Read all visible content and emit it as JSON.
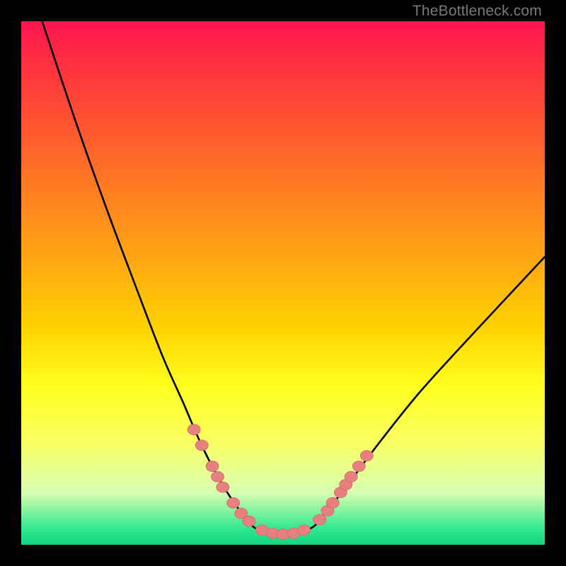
{
  "watermark": "TheBottleneck.com",
  "chart_data": {
    "type": "line",
    "title": "",
    "xlabel": "",
    "ylabel": "",
    "xlim": [
      0,
      100
    ],
    "ylim": [
      0,
      100
    ],
    "series": [
      {
        "name": "bottleneck-curve",
        "x": [
          4,
          10,
          16,
          22,
          27,
          31,
          34,
          37,
          40,
          43,
          45,
          49,
          55,
          58,
          62,
          68,
          76,
          86,
          100
        ],
        "y": [
          100,
          82,
          65,
          49,
          36,
          27,
          20,
          14,
          9,
          5,
          3,
          2,
          3,
          6,
          11,
          19,
          29,
          40,
          55
        ]
      }
    ],
    "markers": {
      "name": "beads",
      "points": [
        {
          "x": 33,
          "y": 22
        },
        {
          "x": 34.5,
          "y": 19
        },
        {
          "x": 36.5,
          "y": 15
        },
        {
          "x": 37.5,
          "y": 13
        },
        {
          "x": 38.5,
          "y": 11
        },
        {
          "x": 40.5,
          "y": 8
        },
        {
          "x": 42,
          "y": 6
        },
        {
          "x": 43.5,
          "y": 4.5
        },
        {
          "x": 46,
          "y": 2.8
        },
        {
          "x": 48,
          "y": 2.2
        },
        {
          "x": 50,
          "y": 2
        },
        {
          "x": 52,
          "y": 2.2
        },
        {
          "x": 54,
          "y": 2.8
        },
        {
          "x": 57,
          "y": 4.8
        },
        {
          "x": 58.5,
          "y": 6.5
        },
        {
          "x": 59.5,
          "y": 8
        },
        {
          "x": 61,
          "y": 10
        },
        {
          "x": 62,
          "y": 11.5
        },
        {
          "x": 63,
          "y": 13
        },
        {
          "x": 64.5,
          "y": 15
        },
        {
          "x": 66,
          "y": 17
        }
      ]
    }
  }
}
